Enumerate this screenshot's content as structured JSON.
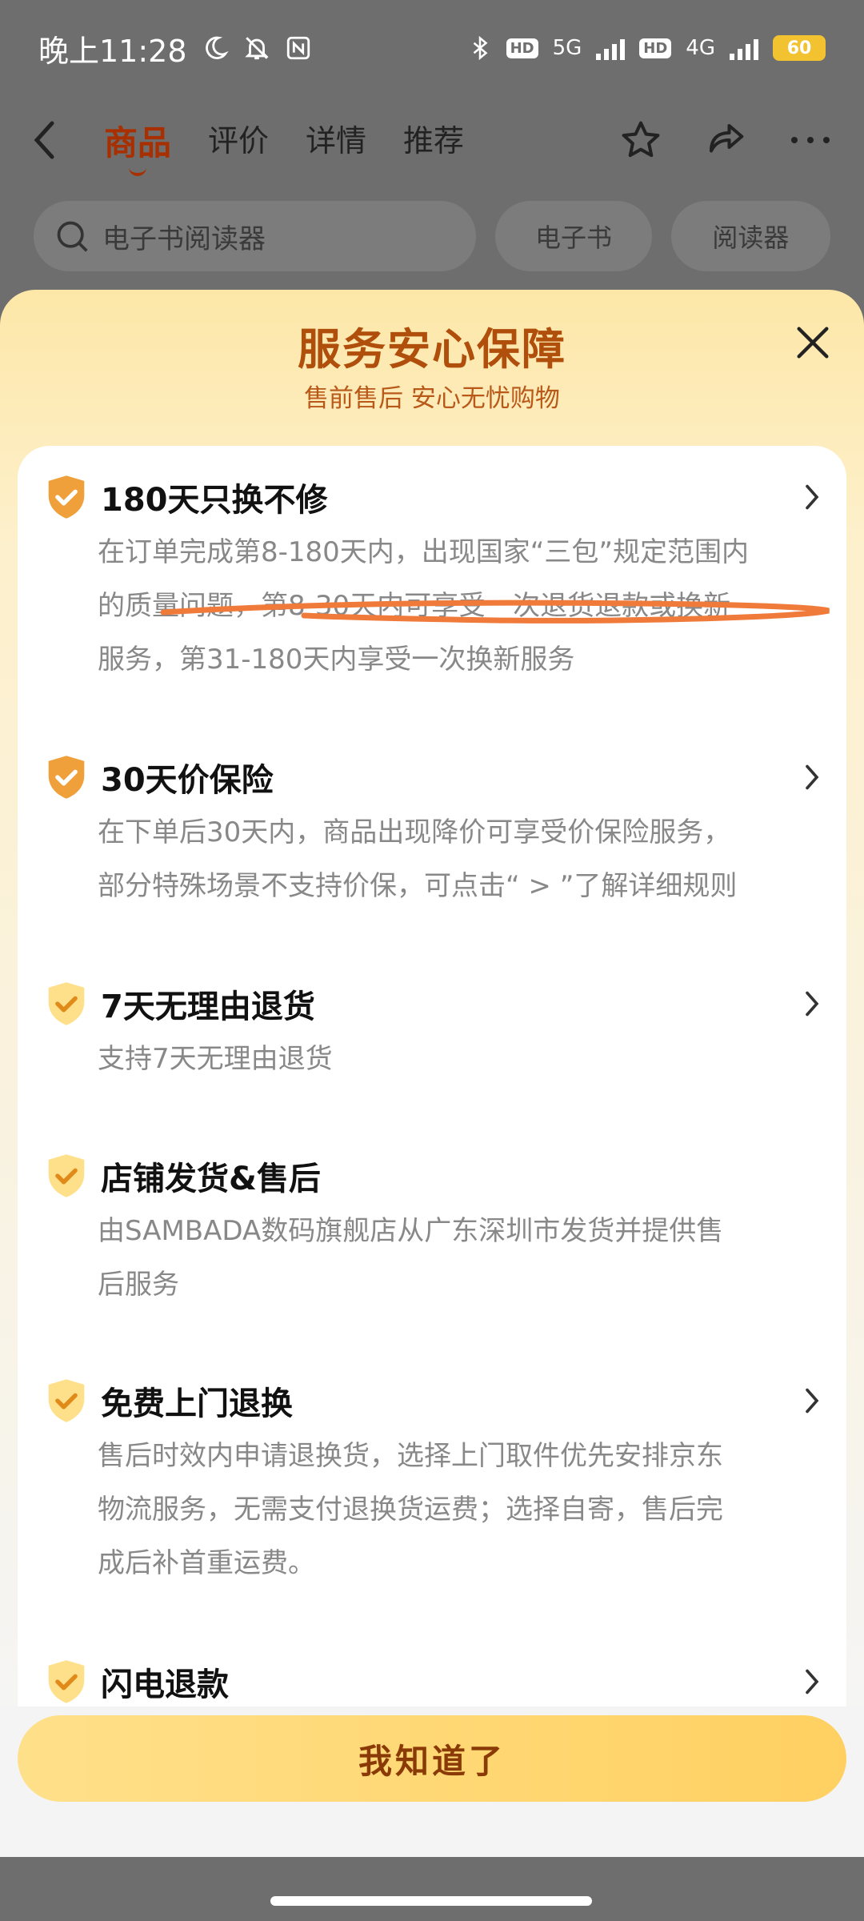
{
  "status": {
    "time": "晚上11:28",
    "net1": "5G",
    "net2": "4G",
    "hd1": "HD",
    "hd2": "HD",
    "battery": "60"
  },
  "nav": {
    "tabs": [
      "商品",
      "评价",
      "详情",
      "推荐"
    ]
  },
  "search": {
    "placeholder": "电子书阅读器",
    "chips": [
      "电子书",
      "阅读器"
    ]
  },
  "sheet": {
    "title": "服务安心保障",
    "subtitle": "售前售后 安心无忧购物",
    "items": [
      {
        "title": "180天只换不修",
        "lines": [
          "在订单完成第8-180天内，出现国家“三包”规定范围内",
          "的质量问题，第8-30天内可享受一次退货退款或换新",
          "服务，第31-180天内享受一次换新服务"
        ]
      },
      {
        "title": "30天价保险",
        "lines": [
          "在下单后30天内，商品出现降价可享受价保险服务，",
          "部分特殊场景不支持价保，可点击“ > ”了解详细规则"
        ]
      },
      {
        "title": "7天无理由退货",
        "lines": [
          "支持7天无理由退货"
        ]
      },
      {
        "title": "店铺发货&售后",
        "lines": [
          "由SAMBADA数码旗舰店从广东深圳市发货并提供售",
          "后服务"
        ]
      },
      {
        "title": "免费上门退换",
        "lines": [
          "售后时效内申请退换货，选择上门取件优先安排京东",
          "物流服务，无需支付退换货运费；选择自寄，售后完",
          "成后补首重运费。"
        ]
      },
      {
        "title": "闪电退款",
        "lines": []
      }
    ],
    "button": "我知道了"
  },
  "colors": {
    "accent": "#b04e0b",
    "shield_orange": "#f0a03a",
    "shield_yellow": "#ffe08a",
    "underline": "#f07a3a"
  }
}
